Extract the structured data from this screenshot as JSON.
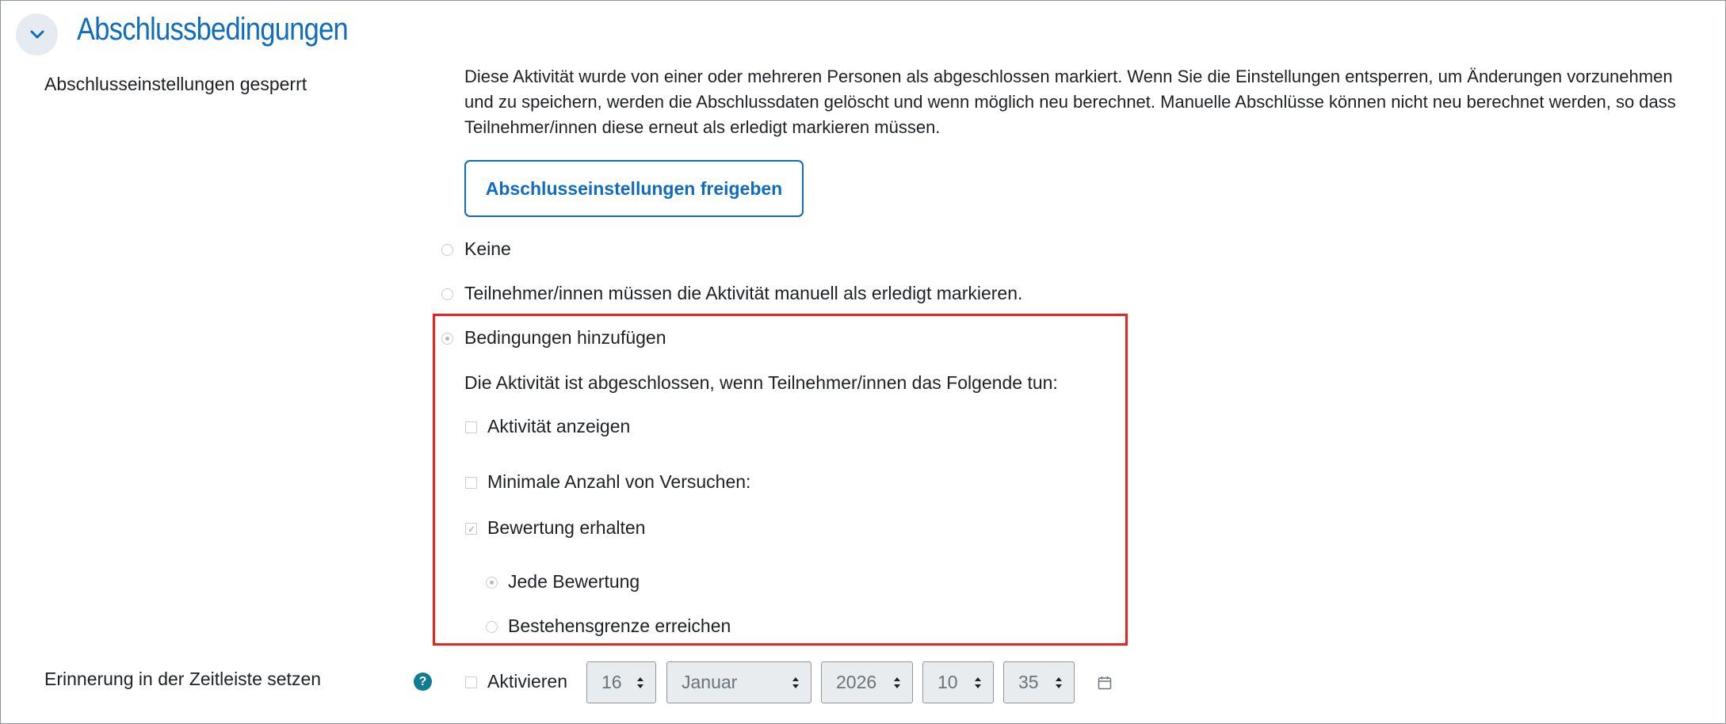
{
  "section": {
    "title": "Abschlussbedingungen",
    "toggle_icon": "chevron-down-icon"
  },
  "locked": {
    "label": "Abschlusseinstellungen gesperrt",
    "description": "Diese Aktivität wurde von einer oder mehreren Personen als abgeschlossen markiert. Wenn Sie die Einstellungen entsperren, um Änderungen vorzunehmen und zu speichern, werden die Abschlussdaten gelöscht und wenn möglich neu berechnet. Manuelle Abschlüsse können nicht neu berechnet werden, so dass Teilnehmer/innen diese erneut als erledigt markieren müssen.",
    "unlock_button": "Abschlusseinstellungen freigeben"
  },
  "completion_options": {
    "none": "Keine",
    "manual": "Teilnehmer/innen müssen die Aktivität manuell als erledigt markieren.",
    "conditions": "Bedingungen hinzufügen",
    "selected": "conditions"
  },
  "conditions": {
    "intro": "Die Aktivität ist abgeschlossen, wenn Teilnehmer/innen das Folgende tun:",
    "view": {
      "label": "Aktivität anzeigen",
      "checked": false
    },
    "min_attempts": {
      "label": "Minimale Anzahl von Versuchen:",
      "checked": false
    },
    "receive_grade": {
      "label": "Bewertung erhalten",
      "checked": true
    },
    "grade_options": {
      "any": "Jede Bewertung",
      "pass": "Bestehensgrenze erreichen",
      "selected": "any"
    }
  },
  "reminder": {
    "label": "Erinnerung in der Zeitleiste setzen",
    "help_icon": "question-circle-icon",
    "enable_label": "Aktivieren",
    "enabled": false,
    "day": "16",
    "month": "Januar",
    "year": "2026",
    "hour": "10",
    "minute": "35",
    "calendar_icon": "calendar-icon"
  },
  "colors": {
    "primary": "#0f6cbf",
    "highlight_border": "#e8231a",
    "help_icon_bg": "#0f7d8f",
    "select_bg": "#e9ecef"
  }
}
